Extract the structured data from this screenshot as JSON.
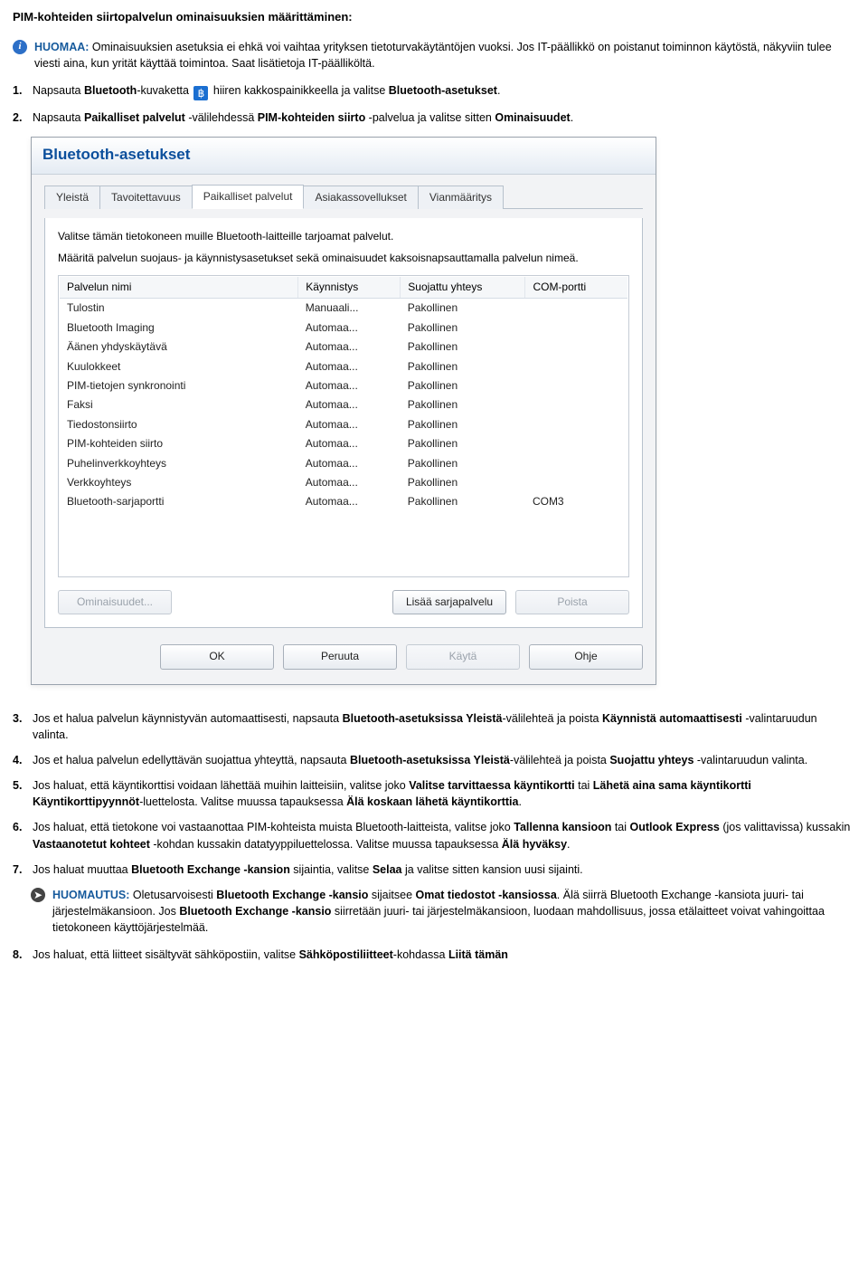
{
  "heading": "PIM-kohteiden siirtopalvelun ominaisuuksien määrittäminen:",
  "notice": {
    "label": "HUOMAA:",
    "text": " Ominaisuuksien asetuksia ei ehkä voi vaihtaa yrityksen tietoturvakäytäntöjen vuoksi. Jos IT-päällikkö on poistanut toiminnon käytöstä, näkyviin tulee viesti aina, kun yrität käyttää toimintoa. Saat lisätietoja IT-päälliköltä."
  },
  "steps": {
    "s1a": "Napsauta ",
    "s1b_bold": "Bluetooth",
    "s1c": "-kuvaketta ",
    "s1d": " hiiren kakkospainikkeella ja valitse ",
    "s1e_bold": "Bluetooth-asetukset",
    "s1f": ".",
    "s2a": "Napsauta ",
    "s2b_bold": "Paikalliset palvelut",
    "s2c": " -välilehdessä ",
    "s2d_bold": "PIM-kohteiden siirto",
    "s2e": " -palvelua ja valitse sitten ",
    "s2f_bold": "Ominaisuudet",
    "s2g": ".",
    "s3a": "Jos et halua palvelun käynnistyvän automaattisesti, napsauta ",
    "s3b_bold": "Bluetooth-asetuksissa Yleistä",
    "s3c": "-välilehteä ja poista ",
    "s3d_bold": "Käynnistä automaattisesti",
    "s3e": " -valintaruudun valinta.",
    "s4a": "Jos et halua palvelun edellyttävän suojattua yhteyttä, napsauta ",
    "s4b_bold": "Bluetooth-asetuksissa Yleistä",
    "s4c": "-välilehteä ja poista ",
    "s4d_bold": "Suojattu yhteys",
    "s4e": " -valintaruudun valinta.",
    "s5a": "Jos haluat, että käyntikorttisi voidaan lähettää muihin laitteisiin, valitse joko ",
    "s5b_bold": "Valitse tarvittaessa käyntikortti",
    "s5c": " tai ",
    "s5d_bold": "Lähetä aina sama käyntikortti Käyntikorttipyynnöt",
    "s5e": "-luettelosta. Valitse muussa tapauksessa ",
    "s5f_bold": "Älä koskaan lähetä käyntikorttia",
    "s5g": ".",
    "s6a": "Jos haluat, että tietokone voi vastaanottaa PIM-kohteista muista Bluetooth-laitteista, valitse joko ",
    "s6b_bold": "Tallenna kansioon",
    "s6c": " tai ",
    "s6d_bold": "Outlook Express",
    "s6e": " (jos valittavissa) kussakin ",
    "s6f_bold": "Vastaanotetut kohteet",
    "s6g": " -kohdan kussakin datatyyppiluettelossa. Valitse muussa tapauksessa ",
    "s6h_bold": "Älä hyväksy",
    "s6i": ".",
    "s7a": "Jos haluat muuttaa ",
    "s7b_bold": "Bluetooth Exchange -kansion",
    "s7c": " sijaintia, valitse ",
    "s7d_bold": "Selaa",
    "s7e": " ja valitse sitten kansion uusi sijainti.",
    "s8a": "Jos haluat, että liitteet sisältyvät sähköpostiin, valitse ",
    "s8b_bold": "Sähköpostiliitteet",
    "s8c": "-kohdassa ",
    "s8d_bold": "Liitä tämän"
  },
  "note2": {
    "label": "HUOMAUTUS:",
    "a": " Oletusarvoisesti ",
    "b_bold": "Bluetooth Exchange -kansio",
    "c": " sijaitsee ",
    "d_bold": "Omat tiedostot -kansiossa",
    "e": ". Älä siirrä Bluetooth Exchange -kansiota juuri- tai järjestelmäkansioon. Jos ",
    "f_bold": "Bluetooth Exchange -kansio",
    "g": " siirretään juuri- tai järjestelmäkansioon, luodaan mahdollisuus, jossa etälaitteet voivat vahingoittaa tietokoneen käyttöjärjestelmää."
  },
  "dialog": {
    "title": "Bluetooth-asetukset",
    "tabs": {
      "general": "Yleistä",
      "discover": "Tavoitettavuus",
      "local": "Paikalliset palvelut",
      "client": "Asiakassovellukset",
      "diag": "Vianmääritys"
    },
    "intro1": "Valitse tämän tietokoneen muille Bluetooth-laitteille tarjoamat palvelut.",
    "intro2": "Määritä palvelun suojaus- ja käynnistysasetukset sekä ominaisuudet kaksoisnapsauttamalla palvelun nimeä.",
    "headers": {
      "name": "Palvelun nimi",
      "startup": "Käynnistys",
      "secure": "Suojattu yhteys",
      "com": "COM-portti"
    },
    "rows": [
      {
        "name": "Tulostin",
        "startup": "Manuaali...",
        "secure": "Pakollinen",
        "com": ""
      },
      {
        "name": "Bluetooth Imaging",
        "startup": "Automaa...",
        "secure": "Pakollinen",
        "com": ""
      },
      {
        "name": "Äänen yhdyskäytävä",
        "startup": "Automaa...",
        "secure": "Pakollinen",
        "com": ""
      },
      {
        "name": "Kuulokkeet",
        "startup": "Automaa...",
        "secure": "Pakollinen",
        "com": ""
      },
      {
        "name": "PIM-tietojen synkronointi",
        "startup": "Automaa...",
        "secure": "Pakollinen",
        "com": ""
      },
      {
        "name": "Faksi",
        "startup": "Automaa...",
        "secure": "Pakollinen",
        "com": ""
      },
      {
        "name": "Tiedostonsiirto",
        "startup": "Automaa...",
        "secure": "Pakollinen",
        "com": ""
      },
      {
        "name": "PIM-kohteiden siirto",
        "startup": "Automaa...",
        "secure": "Pakollinen",
        "com": ""
      },
      {
        "name": "Puhelinverkkoyhteys",
        "startup": "Automaa...",
        "secure": "Pakollinen",
        "com": ""
      },
      {
        "name": "Verkkoyhteys",
        "startup": "Automaa...",
        "secure": "Pakollinen",
        "com": ""
      },
      {
        "name": "Bluetooth-sarjaportti",
        "startup": "Automaa...",
        "secure": "Pakollinen",
        "com": "COM3"
      }
    ],
    "buttons": {
      "props": "Ominaisuudet...",
      "add": "Lisää sarjapalvelu",
      "del": "Poista",
      "ok": "OK",
      "cancel": "Peruuta",
      "apply": "Käytä",
      "help": "Ohje"
    }
  },
  "icons": {
    "bluetooth": "bluetooth-icon",
    "info": "info-icon",
    "arrow": "arrow-right-icon"
  }
}
